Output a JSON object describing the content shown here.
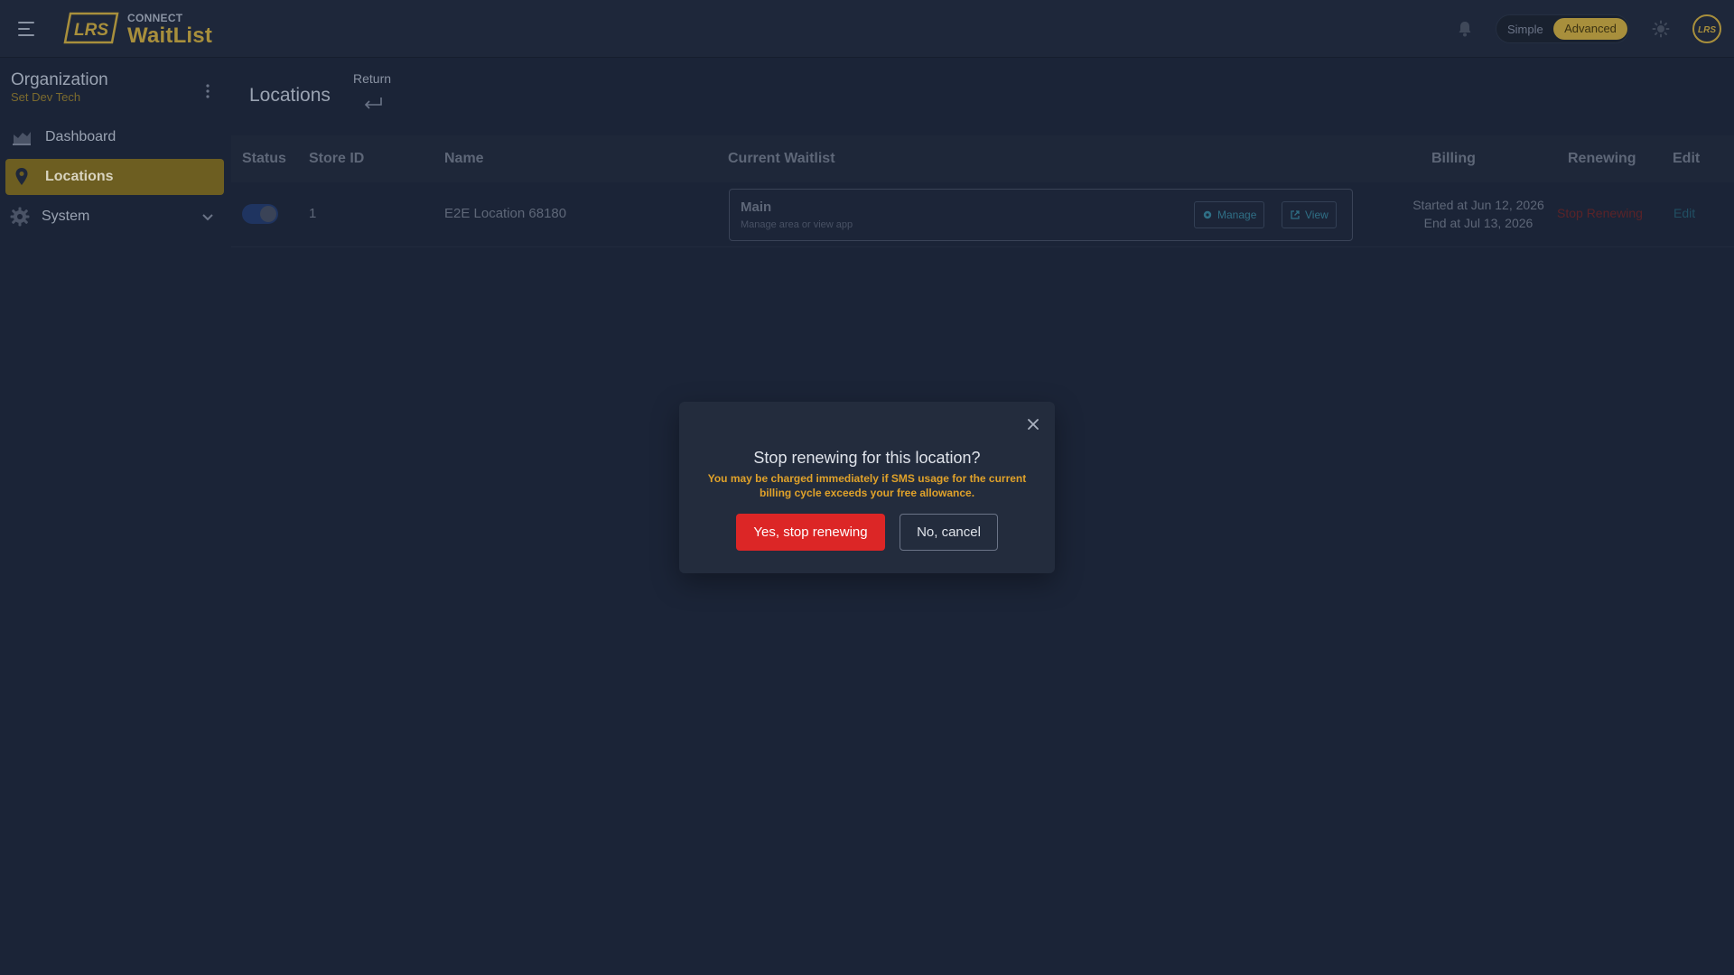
{
  "header": {
    "logo_text": "LRS",
    "brand_small": "CONNECT",
    "brand_big": "WaitList",
    "mode_simple": "Simple",
    "mode_advanced": "Advanced",
    "selected_mode": "Advanced",
    "avatar_text": "LRS"
  },
  "sidebar": {
    "org_title": "Organization",
    "org_name": "Set Dev Tech",
    "items": [
      {
        "label": "Dashboard",
        "icon": "chart-icon",
        "active": false
      },
      {
        "label": "Locations",
        "icon": "map-pin-icon",
        "active": true
      },
      {
        "label": "System",
        "icon": "gear-icon",
        "active": false,
        "expandable": true
      }
    ]
  },
  "page": {
    "title": "Locations",
    "return_label": "Return"
  },
  "table": {
    "columns": [
      "Status",
      "Store ID",
      "Name",
      "Current Waitlist",
      "Billing",
      "Renewing",
      "Edit"
    ],
    "rows": [
      {
        "status_enabled": true,
        "store_id": "1",
        "name": "E2E Location 68180",
        "waitlist_name": "Main",
        "waitlist_desc": "Manage area or view app",
        "manage_label": "Manage",
        "view_label": "View",
        "billing_start": "Started at Jun 12, 2026",
        "billing_end": "End at Jul 13, 2026",
        "renewing_label": "Stop Renewing",
        "edit_label": "Edit"
      }
    ]
  },
  "modal": {
    "title": "Stop renewing for this location?",
    "message": "You may be charged immediately if SMS usage for the current billing cycle exceeds your free allowance.",
    "confirm_label": "Yes, stop renewing",
    "cancel_label": "No, cancel"
  },
  "colors": {
    "accent": "#a88f3c",
    "danger": "#dc2626",
    "warning": "#e0a22a",
    "background": "#1b2437"
  }
}
